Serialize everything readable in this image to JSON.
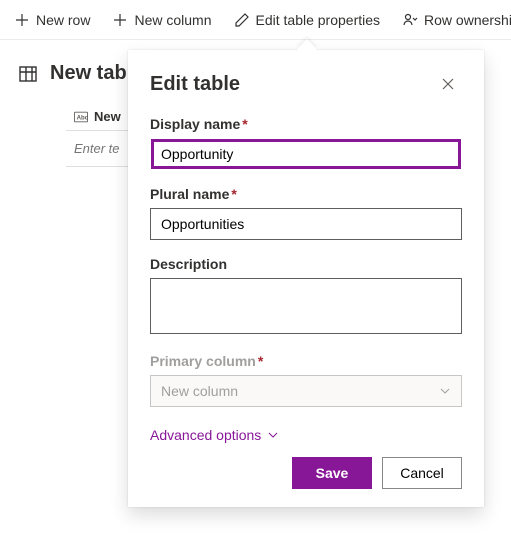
{
  "toolbar": {
    "new_row": "New row",
    "new_column": "New column",
    "edit_props": "Edit table properties",
    "row_ownership": "Row ownership"
  },
  "page": {
    "title": "New tab",
    "column_header": "New",
    "cell_placeholder": "Enter te"
  },
  "panel": {
    "title": "Edit table",
    "display_name_label": "Display name",
    "display_name_value": "Opportunity",
    "plural_name_label": "Plural name",
    "plural_name_value": "Opportunities",
    "description_label": "Description",
    "description_value": "",
    "primary_column_label": "Primary column",
    "primary_column_value": "New column",
    "advanced_options": "Advanced options",
    "save": "Save",
    "cancel": "Cancel"
  }
}
